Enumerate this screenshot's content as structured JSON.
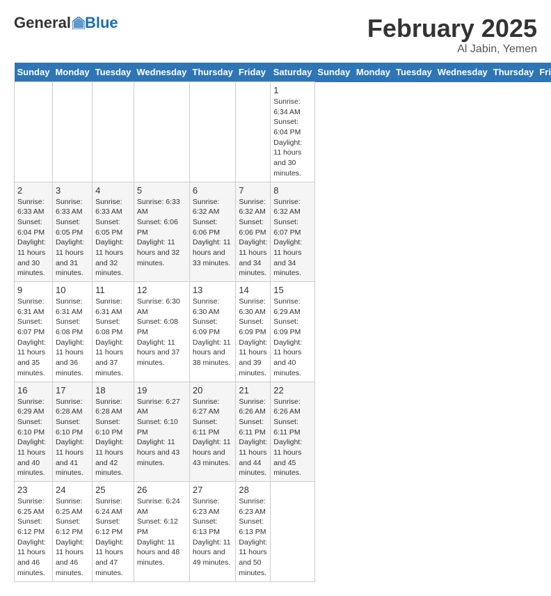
{
  "logo": {
    "general": "General",
    "blue": "Blue"
  },
  "title": "February 2025",
  "location": "Al Jabin, Yemen",
  "days_of_week": [
    "Sunday",
    "Monday",
    "Tuesday",
    "Wednesday",
    "Thursday",
    "Friday",
    "Saturday"
  ],
  "weeks": [
    [
      {
        "day": "",
        "info": ""
      },
      {
        "day": "",
        "info": ""
      },
      {
        "day": "",
        "info": ""
      },
      {
        "day": "",
        "info": ""
      },
      {
        "day": "",
        "info": ""
      },
      {
        "day": "",
        "info": ""
      },
      {
        "day": "1",
        "info": "Sunrise: 6:34 AM\nSunset: 6:04 PM\nDaylight: 11 hours and 30 minutes."
      }
    ],
    [
      {
        "day": "2",
        "info": "Sunrise: 6:33 AM\nSunset: 6:04 PM\nDaylight: 11 hours and 30 minutes."
      },
      {
        "day": "3",
        "info": "Sunrise: 6:33 AM\nSunset: 6:05 PM\nDaylight: 11 hours and 31 minutes."
      },
      {
        "day": "4",
        "info": "Sunrise: 6:33 AM\nSunset: 6:05 PM\nDaylight: 11 hours and 32 minutes."
      },
      {
        "day": "5",
        "info": "Sunrise: 6:33 AM\nSunset: 6:06 PM\nDaylight: 11 hours and 32 minutes."
      },
      {
        "day": "6",
        "info": "Sunrise: 6:32 AM\nSunset: 6:06 PM\nDaylight: 11 hours and 33 minutes."
      },
      {
        "day": "7",
        "info": "Sunrise: 6:32 AM\nSunset: 6:06 PM\nDaylight: 11 hours and 34 minutes."
      },
      {
        "day": "8",
        "info": "Sunrise: 6:32 AM\nSunset: 6:07 PM\nDaylight: 11 hours and 34 minutes."
      }
    ],
    [
      {
        "day": "9",
        "info": "Sunrise: 6:31 AM\nSunset: 6:07 PM\nDaylight: 11 hours and 35 minutes."
      },
      {
        "day": "10",
        "info": "Sunrise: 6:31 AM\nSunset: 6:08 PM\nDaylight: 11 hours and 36 minutes."
      },
      {
        "day": "11",
        "info": "Sunrise: 6:31 AM\nSunset: 6:08 PM\nDaylight: 11 hours and 37 minutes."
      },
      {
        "day": "12",
        "info": "Sunrise: 6:30 AM\nSunset: 6:08 PM\nDaylight: 11 hours and 37 minutes."
      },
      {
        "day": "13",
        "info": "Sunrise: 6:30 AM\nSunset: 6:09 PM\nDaylight: 11 hours and 38 minutes."
      },
      {
        "day": "14",
        "info": "Sunrise: 6:30 AM\nSunset: 6:09 PM\nDaylight: 11 hours and 39 minutes."
      },
      {
        "day": "15",
        "info": "Sunrise: 6:29 AM\nSunset: 6:09 PM\nDaylight: 11 hours and 40 minutes."
      }
    ],
    [
      {
        "day": "16",
        "info": "Sunrise: 6:29 AM\nSunset: 6:10 PM\nDaylight: 11 hours and 40 minutes."
      },
      {
        "day": "17",
        "info": "Sunrise: 6:28 AM\nSunset: 6:10 PM\nDaylight: 11 hours and 41 minutes."
      },
      {
        "day": "18",
        "info": "Sunrise: 6:28 AM\nSunset: 6:10 PM\nDaylight: 11 hours and 42 minutes."
      },
      {
        "day": "19",
        "info": "Sunrise: 6:27 AM\nSunset: 6:10 PM\nDaylight: 11 hours and 43 minutes."
      },
      {
        "day": "20",
        "info": "Sunrise: 6:27 AM\nSunset: 6:11 PM\nDaylight: 11 hours and 43 minutes."
      },
      {
        "day": "21",
        "info": "Sunrise: 6:26 AM\nSunset: 6:11 PM\nDaylight: 11 hours and 44 minutes."
      },
      {
        "day": "22",
        "info": "Sunrise: 6:26 AM\nSunset: 6:11 PM\nDaylight: 11 hours and 45 minutes."
      }
    ],
    [
      {
        "day": "23",
        "info": "Sunrise: 6:25 AM\nSunset: 6:12 PM\nDaylight: 11 hours and 46 minutes."
      },
      {
        "day": "24",
        "info": "Sunrise: 6:25 AM\nSunset: 6:12 PM\nDaylight: 11 hours and 46 minutes."
      },
      {
        "day": "25",
        "info": "Sunrise: 6:24 AM\nSunset: 6:12 PM\nDaylight: 11 hours and 47 minutes."
      },
      {
        "day": "26",
        "info": "Sunrise: 6:24 AM\nSunset: 6:12 PM\nDaylight: 11 hours and 48 minutes."
      },
      {
        "day": "27",
        "info": "Sunrise: 6:23 AM\nSunset: 6:13 PM\nDaylight: 11 hours and 49 minutes."
      },
      {
        "day": "28",
        "info": "Sunrise: 6:23 AM\nSunset: 6:13 PM\nDaylight: 11 hours and 50 minutes."
      },
      {
        "day": "",
        "info": ""
      }
    ]
  ]
}
